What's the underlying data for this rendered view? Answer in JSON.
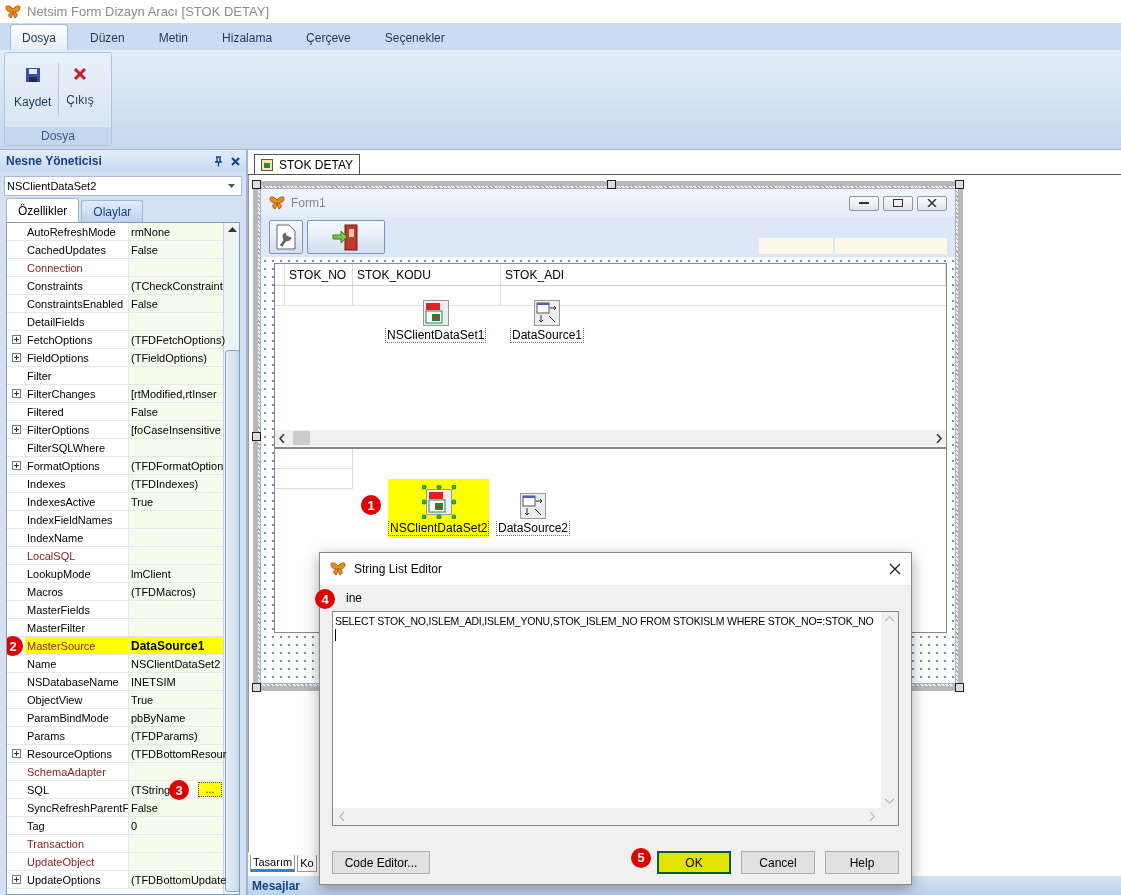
{
  "window": {
    "title": "Netsim Form Dizayn Aracı [STOK DETAY]"
  },
  "ribbon": {
    "tabs": [
      {
        "label": "Dosya",
        "selected": true
      },
      {
        "label": "Düzen",
        "selected": false
      },
      {
        "label": "Metin",
        "selected": false
      },
      {
        "label": "Hizalama",
        "selected": false
      },
      {
        "label": "Çerçeve",
        "selected": false
      },
      {
        "label": "Seçenekler",
        "selected": false
      }
    ],
    "groups": [
      {
        "label": "Dosya",
        "buttons": [
          {
            "label": "Kaydet",
            "kind": "save"
          },
          {
            "label": "Çıkış",
            "kind": "exit"
          }
        ]
      }
    ]
  },
  "object_inspector": {
    "title": "Nesne Yöneticisi",
    "object": "NSClientDataSet2",
    "tabs": [
      {
        "label": "Özellikler",
        "selected": true
      },
      {
        "label": "Olaylar",
        "selected": false
      }
    ],
    "properties": [
      {
        "name": "AutoRefreshMode",
        "value": "rmNone",
        "kind": "plain",
        "expandable": false,
        "highlighted": false
      },
      {
        "name": "CachedUpdates",
        "value": "False",
        "kind": "plain",
        "expandable": false,
        "highlighted": false
      },
      {
        "name": "Connection",
        "kind": "reference",
        "expandable": false,
        "highlighted": false
      },
      {
        "name": "Constraints",
        "value": "(TCheckConstraint",
        "kind": "plain",
        "expandable": false,
        "highlighted": false
      },
      {
        "name": "ConstraintsEnabled",
        "value": "False",
        "kind": "plain",
        "expandable": false,
        "highlighted": false
      },
      {
        "name": "DetailFields",
        "kind": "plain",
        "expandable": false,
        "highlighted": false
      },
      {
        "name": "FetchOptions",
        "value": "(TFDFetchOptions)",
        "kind": "plain",
        "expandable": true,
        "highlighted": false
      },
      {
        "name": "FieldOptions",
        "value": "(TFieldOptions)",
        "kind": "plain",
        "expandable": true,
        "highlighted": false
      },
      {
        "name": "Filter",
        "kind": "plain",
        "expandable": false,
        "highlighted": false
      },
      {
        "name": "FilterChanges",
        "value": "[rtModified,rtInser",
        "kind": "plain",
        "expandable": true,
        "highlighted": false
      },
      {
        "name": "Filtered",
        "value": "False",
        "kind": "plain",
        "expandable": false,
        "highlighted": false
      },
      {
        "name": "FilterOptions",
        "value": "[foCaseInsensitive",
        "kind": "plain",
        "expandable": true,
        "highlighted": false
      },
      {
        "name": "FilterSQLWhere",
        "kind": "plain",
        "expandable": false,
        "highlighted": false
      },
      {
        "name": "FormatOptions",
        "value": "(TFDFormatOption",
        "kind": "plain",
        "expandable": true,
        "highlighted": false
      },
      {
        "name": "Indexes",
        "value": "(TFDIndexes)",
        "kind": "plain",
        "expandable": false,
        "highlighted": false
      },
      {
        "name": "IndexesActive",
        "value": "True",
        "kind": "plain",
        "expandable": false,
        "highlighted": false
      },
      {
        "name": "IndexFieldNames",
        "kind": "plain",
        "expandable": false,
        "highlighted": false
      },
      {
        "name": "IndexName",
        "kind": "plain",
        "expandable": false,
        "highlighted": false
      },
      {
        "name": "LocalSQL",
        "kind": "reference",
        "expandable": false,
        "highlighted": false
      },
      {
        "name": "LookupMode",
        "value": "lmClient",
        "kind": "plain",
        "expandable": false,
        "highlighted": false
      },
      {
        "name": "Macros",
        "value": "(TFDMacros)",
        "kind": "plain",
        "expandable": false,
        "highlighted": false
      },
      {
        "name": "MasterFields",
        "kind": "plain",
        "expandable": false,
        "highlighted": false
      },
      {
        "name": "MasterFilter",
        "kind": "plain",
        "expandable": false,
        "highlighted": false
      },
      {
        "name": "MasterSource",
        "value": "DataSource1",
        "kind": "reference",
        "expandable": false,
        "highlighted": true,
        "badge": "2"
      },
      {
        "name": "Name",
        "value": "NSClientDataSet2",
        "kind": "plain",
        "expandable": false,
        "highlighted": false
      },
      {
        "name": "NSDatabaseName",
        "value": "INETSIM",
        "kind": "plain",
        "expandable": false,
        "highlighted": false
      },
      {
        "name": "ObjectView",
        "value": "True",
        "kind": "plain",
        "expandable": false,
        "highlighted": false
      },
      {
        "name": "ParamBindMode",
        "value": "pbByName",
        "kind": "plain",
        "expandable": false,
        "highlighted": false
      },
      {
        "name": "Params",
        "value": "(TFDParams)",
        "kind": "plain",
        "expandable": false,
        "highlighted": false
      },
      {
        "name": "ResourceOptions",
        "value": "(TFDBottomResour",
        "kind": "plain",
        "expandable": true,
        "highlighted": false
      },
      {
        "name": "SchemaAdapter",
        "kind": "reference",
        "expandable": false,
        "highlighted": false
      },
      {
        "name": "SQL",
        "value": "(TString",
        "kind": "plain",
        "expandable": false,
        "highlighted": false,
        "badge": "3",
        "button": "..."
      },
      {
        "name": "SyncRefreshParentF",
        "value": "False",
        "kind": "plain",
        "expandable": false,
        "highlighted": false
      },
      {
        "name": "Tag",
        "value": "0",
        "kind": "plain",
        "expandable": false,
        "highlighted": false
      },
      {
        "name": "Transaction",
        "kind": "reference",
        "expandable": false,
        "highlighted": false
      },
      {
        "name": "UpdateObject",
        "kind": "reference",
        "expandable": false,
        "highlighted": false
      },
      {
        "name": "UpdateOptions",
        "value": "(TFDBottomUpdate",
        "kind": "plain",
        "expandable": true,
        "highlighted": false
      }
    ]
  },
  "document_tabs": [
    {
      "label": "STOK DETAY",
      "selected": true
    }
  ],
  "form": {
    "title": "Form1",
    "grids": [
      {
        "columns": [
          "STOK_NO",
          "STOK_KODU",
          "STOK_ADI"
        ],
        "components": [
          {
            "label": "NSClientDataSet1",
            "kind": "dataset",
            "selected": false
          },
          {
            "label": "DataSource1",
            "kind": "datasource",
            "selected": false
          }
        ]
      },
      {
        "components": [
          {
            "label": "NSClientDataSet2",
            "kind": "dataset",
            "selected": true,
            "badge": "1"
          },
          {
            "label": "DataSource2",
            "kind": "datasource",
            "selected": false
          }
        ]
      }
    ]
  },
  "bottom_tabs": [
    {
      "label": "Tasarım",
      "selected": true
    },
    {
      "label": "Ko",
      "selected": false
    }
  ],
  "messages_panel": {
    "title": "Mesajlar"
  },
  "dialog": {
    "title": "String List Editor",
    "label": "ine",
    "label_badge": "4",
    "text": "SELECT STOK_NO,ISLEM_ADI,ISLEM_YONU,STOK_ISLEM_NO FROM STOKISLM WHERE STOK_NO=:STOK_NO",
    "buttons": [
      {
        "label": "Code Editor...",
        "highlighted": false
      },
      {
        "label": "OK",
        "highlighted": true,
        "badge": "5"
      },
      {
        "label": "Cancel",
        "highlighted": false
      },
      {
        "label": "Help",
        "highlighted": false
      }
    ]
  }
}
